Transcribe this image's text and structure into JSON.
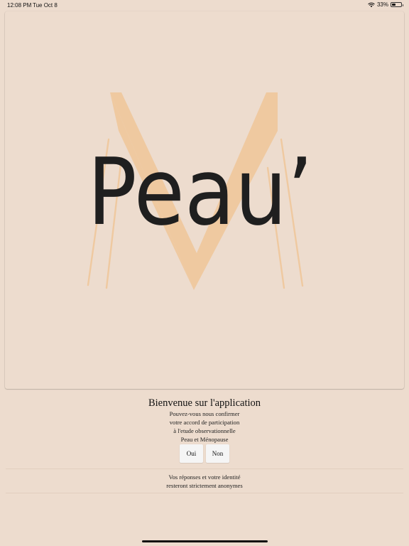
{
  "status_bar": {
    "time": "12:08 PM",
    "date": "Tue Oct 8",
    "battery_percent": "33%",
    "battery_level": 0.33,
    "wifi_icon": "wifi-icon",
    "battery_icon": "battery-icon"
  },
  "logo": {
    "text": "Peau’",
    "monogram_color": "#efc9a0",
    "text_color": "#1f1f1f"
  },
  "welcome": {
    "title": "Bienvenue sur l'application",
    "prompt_lines": [
      "Pouvez-vous nous confirmer",
      "votre accord de participation",
      "à l'etude observationnelle",
      "Peau et Ménopause"
    ]
  },
  "actions": {
    "yes_label": "Oui",
    "no_label": "Non"
  },
  "anonymity": {
    "lines": [
      "Vos réponses et votre identité",
      "resteront strictement anonymes"
    ]
  },
  "colors": {
    "background": "#eddcce",
    "accent": "#efc9a0",
    "button_bg": "#f5f5f5"
  }
}
